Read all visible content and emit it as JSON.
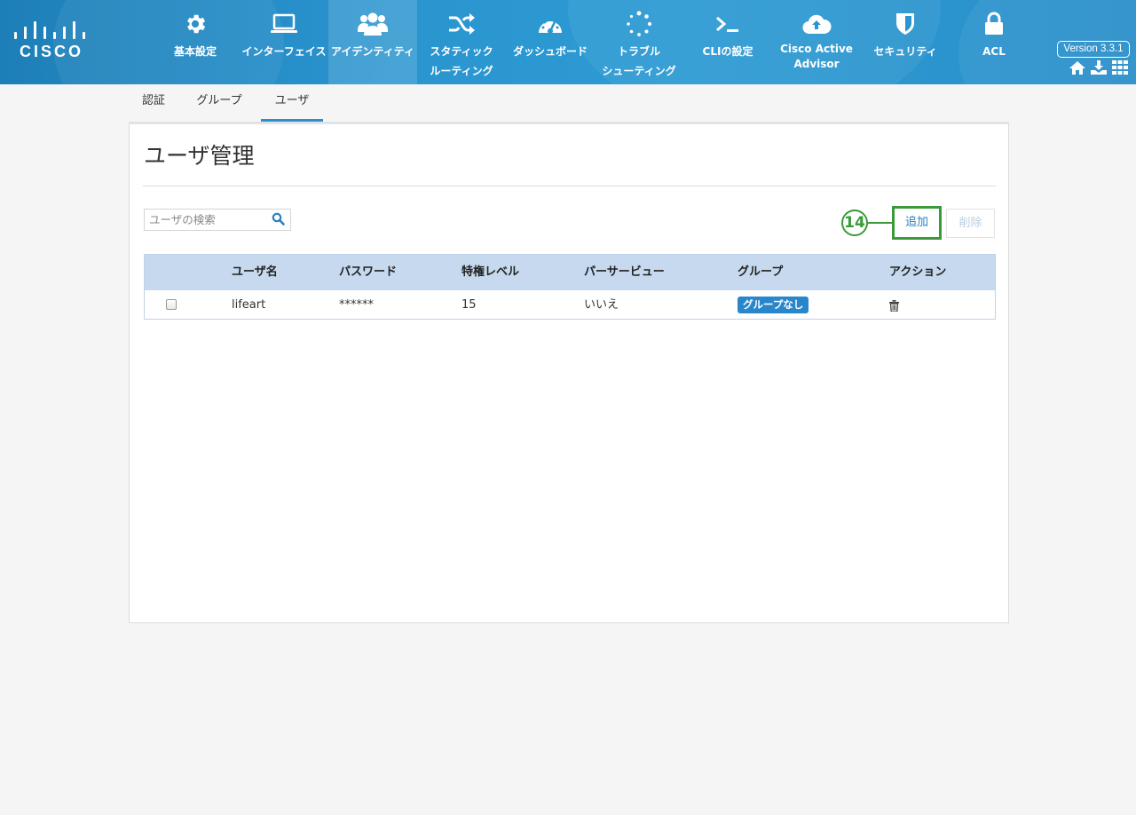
{
  "header": {
    "brand": "CISCO",
    "nav": [
      {
        "id": "basic",
        "label": "基本設定",
        "icon": "gear-icon"
      },
      {
        "id": "interface",
        "label": "インターフェイス",
        "icon": "laptop-icon"
      },
      {
        "id": "identity",
        "label": "アイデンティティ",
        "icon": "users-icon",
        "active": true
      },
      {
        "id": "static-routing",
        "label": "スタティック\nルーティング",
        "icon": "shuffle-icon"
      },
      {
        "id": "dashboard",
        "label": "ダッシュボード",
        "icon": "dashboard-icon"
      },
      {
        "id": "troubleshoot",
        "label": "トラブル\nシューティング",
        "icon": "spinner-icon"
      },
      {
        "id": "cli",
        "label": "CLIの設定",
        "icon": "terminal-icon"
      },
      {
        "id": "advisor",
        "label": "Cisco Active\nAdvisor",
        "icon": "cloud-upload-icon"
      },
      {
        "id": "security",
        "label": "セキュリティ",
        "icon": "shield-icon"
      },
      {
        "id": "acl",
        "label": "ACL",
        "icon": "lock-icon"
      }
    ],
    "version": "Version 3.3.1",
    "right_icons": [
      "home-icon",
      "download-icon",
      "grid-icon"
    ]
  },
  "subtabs": [
    {
      "label": "認証"
    },
    {
      "label": "グループ"
    },
    {
      "label": "ユーザ",
      "active": true
    }
  ],
  "page": {
    "title": "ユーザ管理",
    "search_placeholder": "ユーザの検索",
    "callout": "14",
    "add_label": "追加",
    "delete_label": "削除"
  },
  "table": {
    "columns": [
      "ユーザ名",
      "パスワード",
      "特権レベル",
      "パーサービュー",
      "グループ",
      "アクション"
    ],
    "rows": [
      {
        "username": "lifeart",
        "password": "******",
        "privilege": "15",
        "parser_view": "いいえ",
        "group": "グループなし"
      }
    ]
  },
  "colors": {
    "header": "#2a95cf",
    "accent": "#2d8fce",
    "callout": "#3a9a3a",
    "table_header": "#c6d9ee"
  }
}
